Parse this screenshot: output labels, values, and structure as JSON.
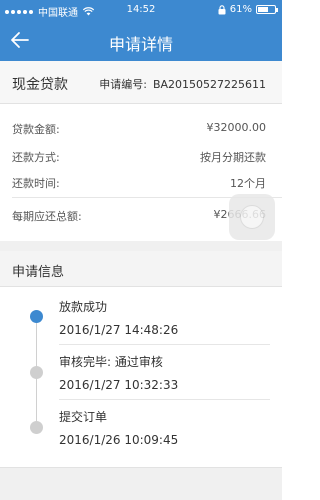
{
  "status_bar": {
    "carrier": "中国联通",
    "time": "14:52",
    "battery": "61%"
  },
  "nav": {
    "title": "申请详情"
  },
  "loan": {
    "type": "现金贷款",
    "application_no_label": "申请编号:",
    "application_no": "BA20150527225611"
  },
  "details": [
    {
      "label": "贷款金额:",
      "value": "¥32000.00"
    },
    {
      "label": "还款方式:",
      "value": "按月分期还款"
    },
    {
      "label": "还款时间:",
      "value": "12个月"
    },
    {
      "label": "每期应还总额:",
      "value": "¥2666.66"
    }
  ],
  "section": {
    "title": "申请信息"
  },
  "timeline": [
    {
      "title": "放款成功",
      "time": "2016/1/27  14:48:26",
      "active": true
    },
    {
      "title": "审核完毕: 通过审核",
      "time": "2016/1/27  10:32:33",
      "active": false
    },
    {
      "title": "提交订单",
      "time": "2016/1/26  10:09:45",
      "active": false
    }
  ],
  "colors": {
    "accent": "#3d89d0",
    "inactive_dot": "#cfcfcf"
  },
  "icons": [
    "back-arrow-icon",
    "wifi-icon",
    "lock-icon",
    "battery-icon",
    "signal-icon"
  ]
}
